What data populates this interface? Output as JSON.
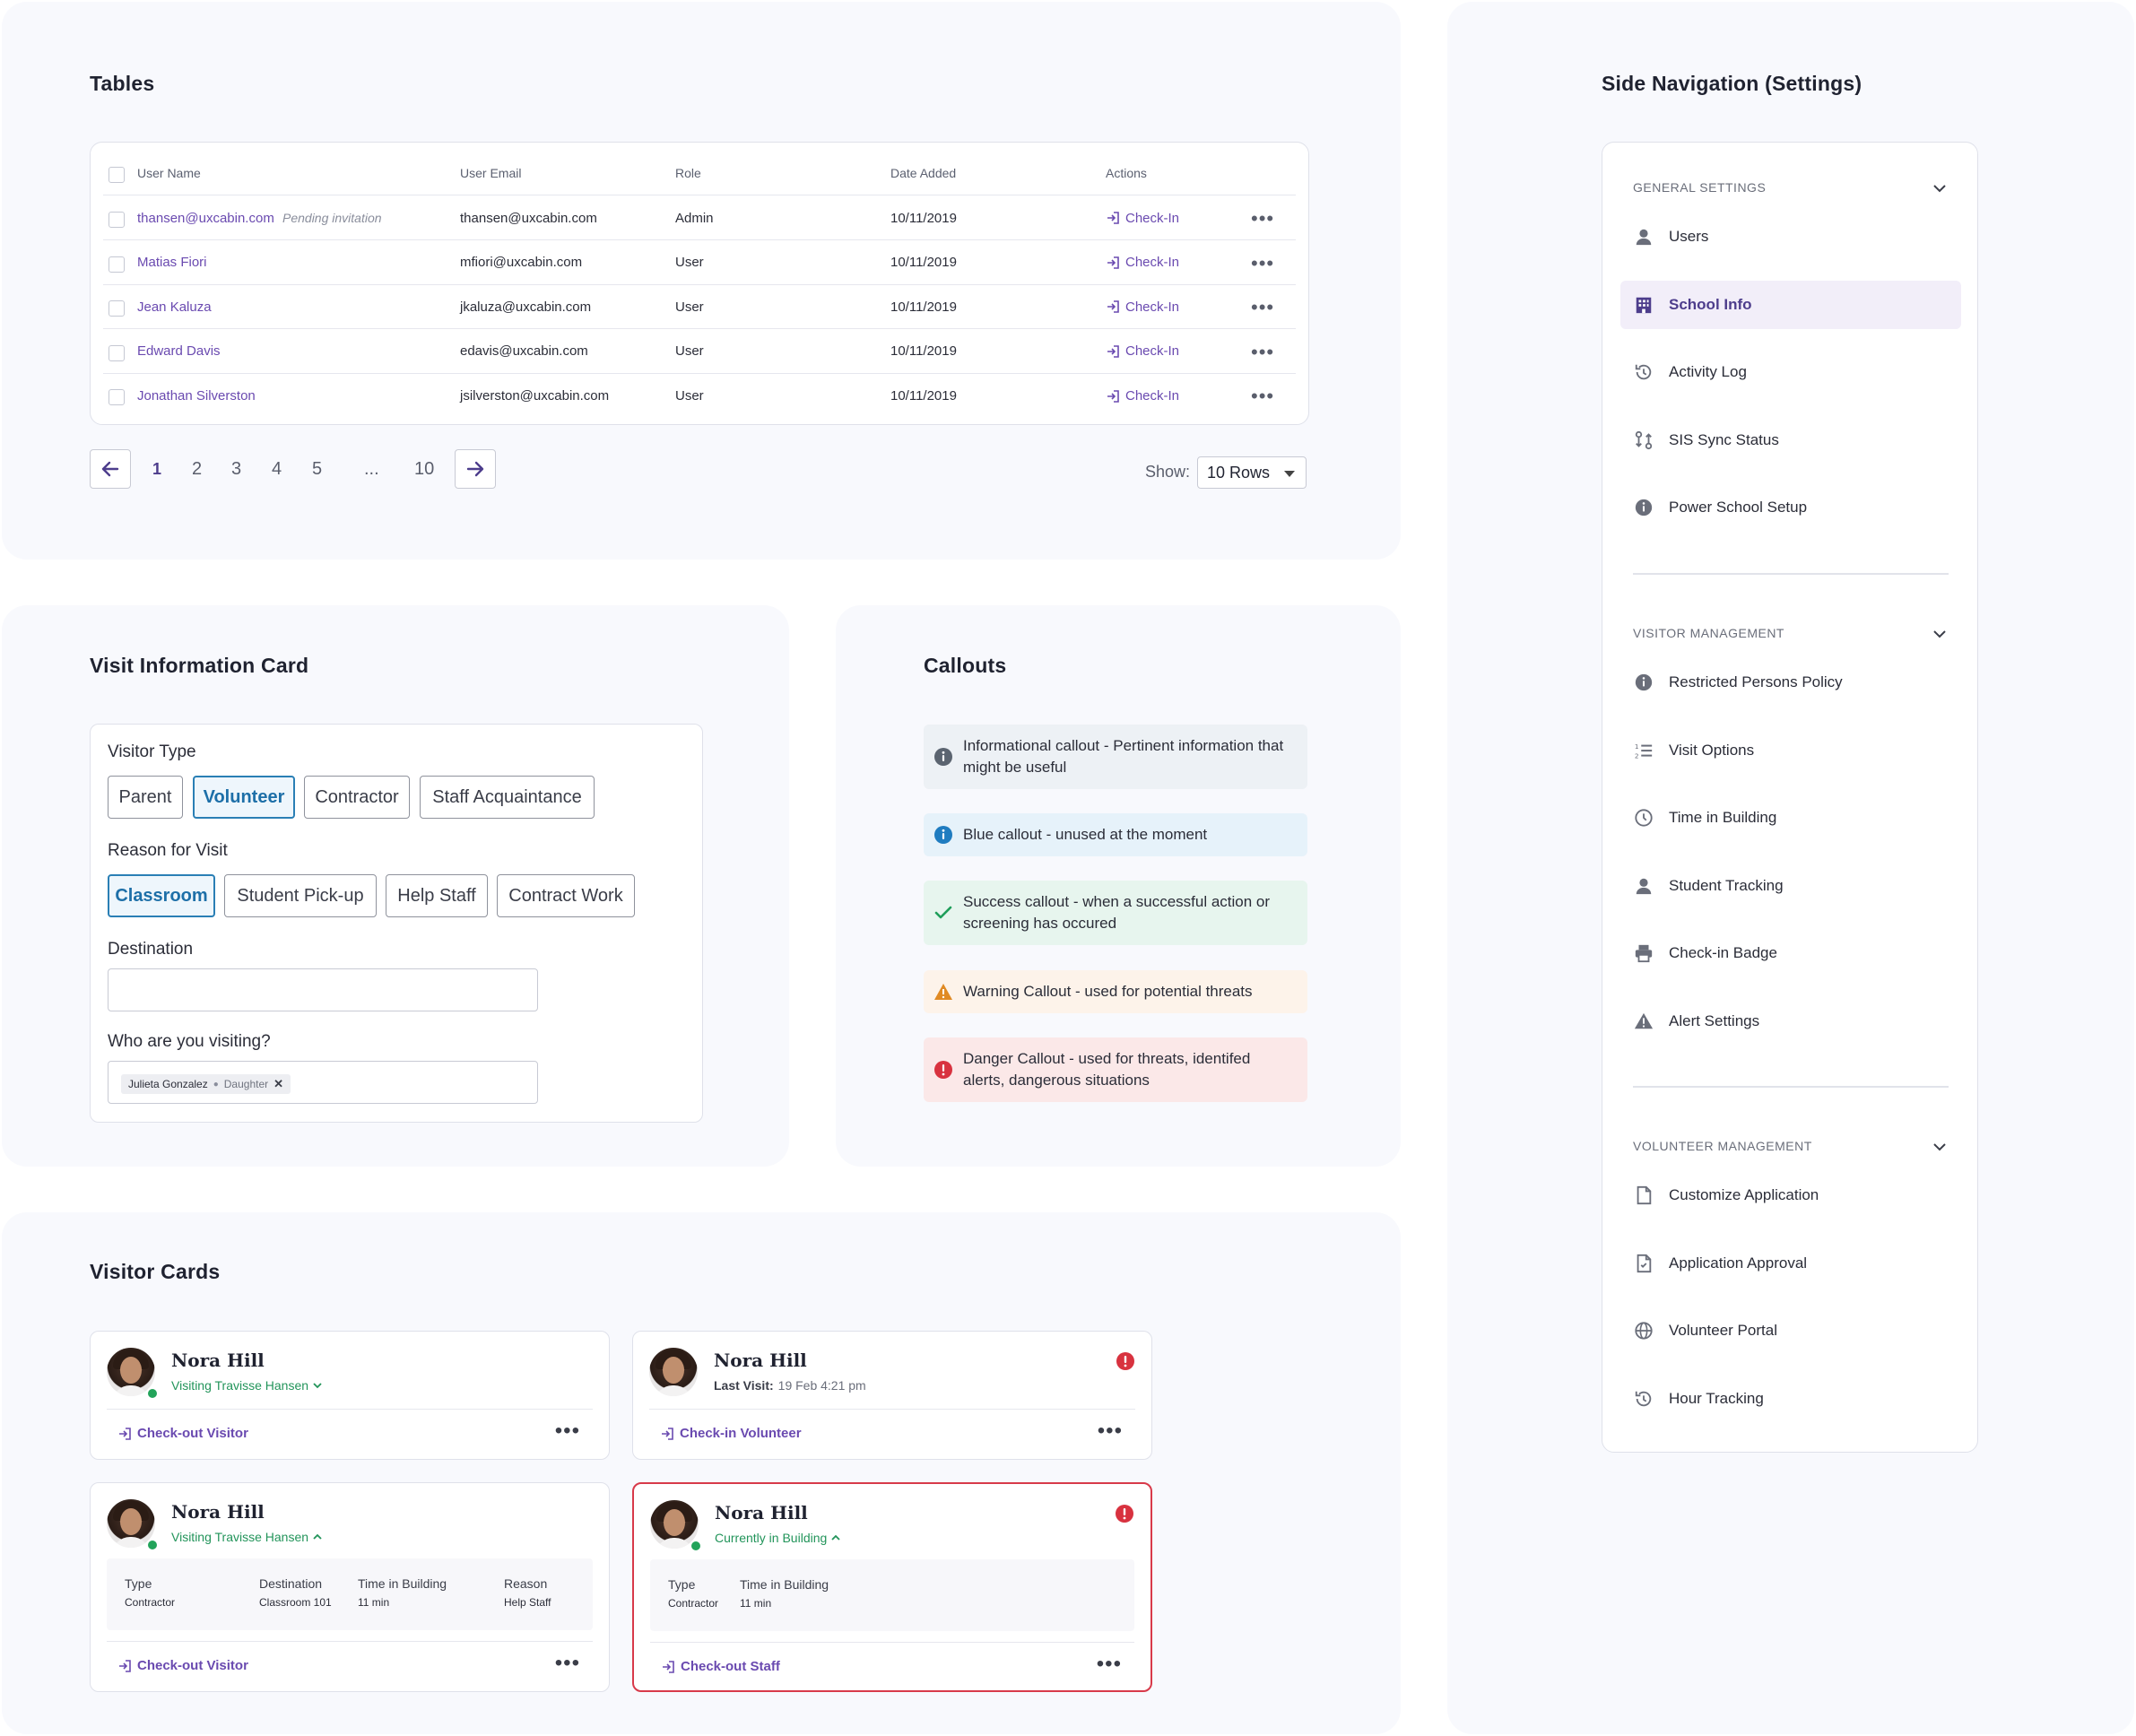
{
  "tables": {
    "title": "Tables",
    "headers": {
      "name": "User Name",
      "email": "User Email",
      "role": "Role",
      "date": "Date Added",
      "actions": "Actions"
    },
    "rows": [
      {
        "name": "thansen@uxcabin.com",
        "pending": "Pending invitation",
        "email": "thansen@uxcabin.com",
        "role": "Admin",
        "date": "10/11/2019",
        "action": "Check-In"
      },
      {
        "name": "Matias Fiori",
        "pending": "",
        "email": "mfiori@uxcabin.com",
        "role": "User",
        "date": "10/11/2019",
        "action": "Check-In"
      },
      {
        "name": "Jean Kaluza",
        "pending": "",
        "email": "jkaluza@uxcabin.com",
        "role": "User",
        "date": "10/11/2019",
        "action": "Check-In"
      },
      {
        "name": "Edward Davis",
        "pending": "",
        "email": "edavis@uxcabin.com",
        "role": "User",
        "date": "10/11/2019",
        "action": "Check-In"
      },
      {
        "name": "Jonathan Silverston",
        "pending": "",
        "email": "jsilverston@uxcabin.com",
        "role": "User",
        "date": "10/11/2019",
        "action": "Check-In"
      }
    ],
    "pagination": {
      "pages": [
        "1",
        "2",
        "3",
        "4",
        "5",
        "...",
        "10"
      ],
      "current": "1"
    },
    "show_label": "Show:",
    "rows_value": "10 Rows"
  },
  "visit": {
    "title": "Visit Information Card",
    "visitor_type_label": "Visitor Type",
    "visitor_types": [
      "Parent",
      "Volunteer",
      "Contractor",
      "Staff Acquaintance"
    ],
    "visitor_type_selected": "Volunteer",
    "reason_label": "Reason for Visit",
    "reasons": [
      "Classroom",
      "Student Pick-up",
      "Help Staff",
      "Contract Work"
    ],
    "reason_selected": "Classroom",
    "destination_label": "Destination",
    "destination_value": "",
    "visiting_label": "Who are you visiting?",
    "visiting_tag_name": "Julieta Gonzalez",
    "visiting_tag_relation": "Daughter"
  },
  "callouts": {
    "title": "Callouts",
    "items": [
      {
        "kind": "info",
        "text": "Informational callout - Pertinent information that might be useful",
        "bg": "#edf1f5",
        "icon_color": "#5b6470"
      },
      {
        "kind": "blue",
        "text": "Blue callout - unused at the moment",
        "bg": "#e6f2fa",
        "icon_color": "#1f7cc0"
      },
      {
        "kind": "success",
        "text": "Success callout - when a successful action or screening has occured",
        "bg": "#e7f5ee",
        "icon_color": "#1f9e5a"
      },
      {
        "kind": "warning",
        "text": "Warning Callout - used for potential threats",
        "bg": "#fdf3ea",
        "icon_color": "#e08a24"
      },
      {
        "kind": "danger",
        "text": "Danger Callout - used for threats, identifed alerts, dangerous situations",
        "bg": "#fbe8e8",
        "icon_color": "#d8323f"
      }
    ]
  },
  "visitor_cards": {
    "title": "Visitor Cards",
    "cards": [
      {
        "name": "Nora Hill",
        "sub": "Visiting Travisse Hansen",
        "action": "Check-out Visitor"
      },
      {
        "name": "Nora Hill",
        "sub_label": "Last Visit:",
        "sub_value": "19 Feb 4:21 pm",
        "action": "Check-in Volunteer"
      },
      {
        "name": "Nora Hill",
        "sub": "Visiting Travisse Hansen",
        "action": "Check-out Visitor",
        "details": [
          {
            "k": "Type",
            "v": "Contractor"
          },
          {
            "k": "Destination",
            "v": "Classroom 101"
          },
          {
            "k": "Time in Building",
            "v": "11 min"
          },
          {
            "k": "Reason",
            "v": "Help Staff"
          }
        ]
      },
      {
        "name": "Nora Hill",
        "sub": "Currently in Building",
        "action": "Check-out Staff",
        "details": [
          {
            "k": "Type",
            "v": "Contractor"
          },
          {
            "k": "Time in Building",
            "v": "11 min"
          }
        ]
      }
    ]
  },
  "side_nav": {
    "title": "Side Navigation (Settings)",
    "sections": [
      {
        "label": "GENERAL SETTINGS",
        "items": [
          {
            "label": "Users",
            "icon": "user-icon"
          },
          {
            "label": "School Info",
            "icon": "building-icon",
            "active": true
          },
          {
            "label": "Activity Log",
            "icon": "history-icon"
          },
          {
            "label": "SIS Sync Status",
            "icon": "sync-icon"
          },
          {
            "label": "Power School Setup",
            "icon": "info-icon"
          }
        ]
      },
      {
        "label": "VISITOR MANAGEMENT",
        "items": [
          {
            "label": "Restricted Persons Policy",
            "icon": "info-icon"
          },
          {
            "label": "Visit Options",
            "icon": "numbered-list-icon"
          },
          {
            "label": "Time in Building",
            "icon": "clock-icon"
          },
          {
            "label": "Student Tracking",
            "icon": "user-icon"
          },
          {
            "label": "Check-in Badge",
            "icon": "printer-icon"
          },
          {
            "label": "Alert Settings",
            "icon": "warning-icon"
          }
        ]
      },
      {
        "label": "VOLUNTEER MANAGEMENT",
        "items": [
          {
            "label": "Customize Application",
            "icon": "document-icon"
          },
          {
            "label": "Application Approval",
            "icon": "document-check-icon"
          },
          {
            "label": "Volunteer Portal",
            "icon": "globe-icon"
          },
          {
            "label": "Hour Tracking",
            "icon": "history-icon"
          }
        ]
      }
    ]
  },
  "colors": {
    "brand_purple": "#6a4ab0",
    "panel_bg": "#f8f9fd",
    "success_green": "#22945a",
    "danger_red": "#d83a4a",
    "selected_blue": "#1d6fa8"
  }
}
